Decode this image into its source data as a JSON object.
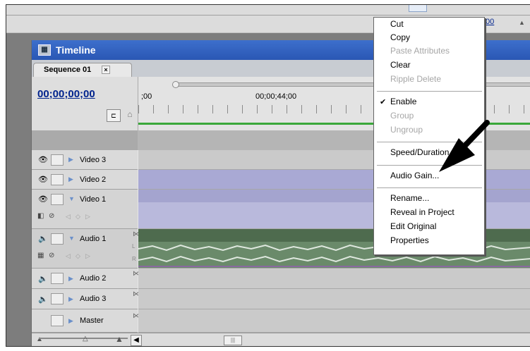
{
  "top": {
    "timecode": ";00"
  },
  "panel": {
    "title": "Timeline",
    "tab_label": "Sequence 01",
    "tab_close": "×",
    "timecode": "00;00;00;00",
    "ruler_labels": [
      ";00",
      "00;00;44;00"
    ]
  },
  "tracks": {
    "video3": "Video 3",
    "video2": "Video 2",
    "video1": "Video 1",
    "audio1": "Audio 1",
    "audio2": "Audio 2",
    "audio3": "Audio 3",
    "master": "Master",
    "channel_l": "L",
    "channel_r": "R"
  },
  "context_menu": {
    "items": [
      {
        "label": "Cut",
        "enabled": true
      },
      {
        "label": "Copy",
        "enabled": true
      },
      {
        "label": "Paste Attributes",
        "enabled": false
      },
      {
        "label": "Clear",
        "enabled": true
      },
      {
        "label": "Ripple Delete",
        "enabled": false
      },
      {
        "label": "Enable",
        "enabled": true,
        "checked": true
      },
      {
        "label": "Group",
        "enabled": false
      },
      {
        "label": "Ungroup",
        "enabled": false
      },
      {
        "label": "Speed/Duration...",
        "enabled": true
      },
      {
        "label": "Audio Gain...",
        "enabled": true
      },
      {
        "label": "Rename...",
        "enabled": true
      },
      {
        "label": "Reveal in Project",
        "enabled": true
      },
      {
        "label": "Edit Original",
        "enabled": true
      },
      {
        "label": "Properties",
        "enabled": true
      }
    ]
  },
  "colors": {
    "titlebar": "#2d5fbd",
    "video_clip": "#a9a9d4",
    "audio_clip": "#4e6b4e",
    "timecode": "#00238d"
  },
  "icons": {
    "eye": "eye-icon",
    "speaker": "speaker-icon",
    "pointer_arrow": "black-arrow-annotation"
  }
}
